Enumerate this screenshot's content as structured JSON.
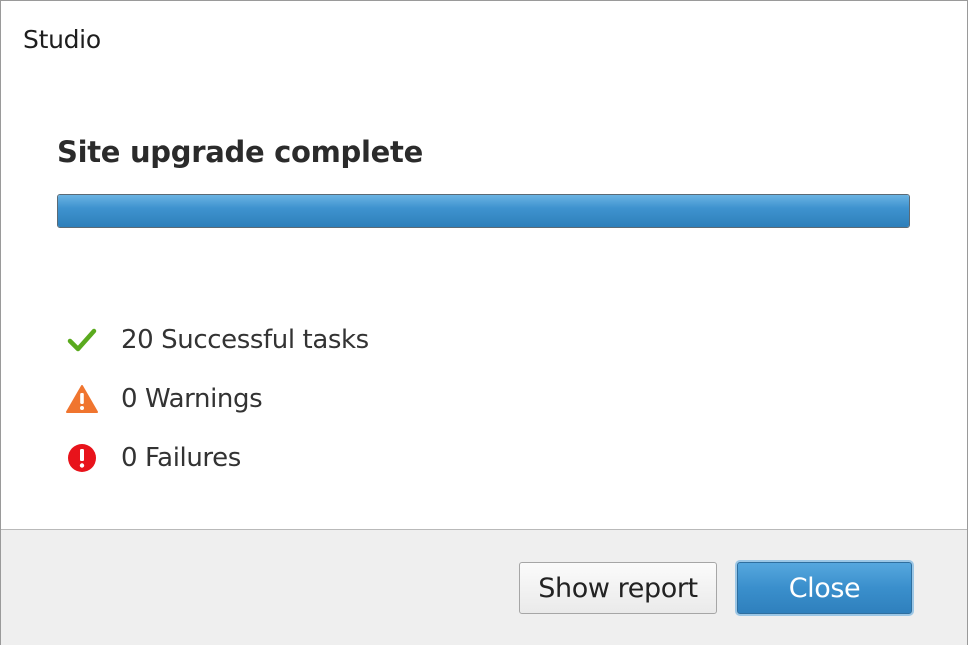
{
  "window": {
    "title": "Studio"
  },
  "status": {
    "heading": "Site upgrade complete",
    "progress_fraction": 1.0
  },
  "summary": {
    "successful": "20 Successful tasks",
    "warnings": "0 Warnings",
    "failures": "0 Failures"
  },
  "buttons": {
    "show_report": "Show report",
    "close": "Close"
  },
  "colors": {
    "success_icon": "#5aaa1e",
    "warning_icon": "#f0752f",
    "failure_icon": "#e8131b",
    "progress": "#3a8fcc",
    "accent_button": "#3a8fcc"
  },
  "icons": {
    "success": "checkmark-icon",
    "warning": "warning-triangle-icon",
    "failure": "error-circle-icon"
  }
}
